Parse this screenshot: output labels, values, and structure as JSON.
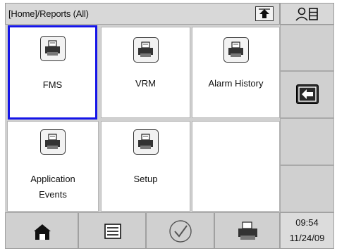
{
  "header": {
    "breadcrumb": "[Home]/Reports (All)",
    "up_icon": "up-arrow-icon",
    "user_icon": "user-list-icon"
  },
  "tiles": [
    {
      "label": "FMS",
      "icon": "printer-icon",
      "selected": true
    },
    {
      "label": "VRM",
      "icon": "printer-icon",
      "selected": false
    },
    {
      "label": "Alarm History",
      "icon": "printer-icon",
      "selected": false
    },
    {
      "label_line1": "Application",
      "label_line2": "Events",
      "icon": "printer-icon",
      "selected": false
    },
    {
      "label": "Setup",
      "icon": "printer-icon",
      "selected": false
    }
  ],
  "side": {
    "back_icon": "back-arrow-icon"
  },
  "bottom_bar": {
    "buttons": [
      "home-icon",
      "list-icon",
      "checkmark-icon",
      "printer-icon"
    ],
    "time": "09:54",
    "date": "11/24/09"
  },
  "colors": {
    "selection": "#1515e8",
    "panel": "#d0d0d0",
    "tile": "#ffffff"
  }
}
